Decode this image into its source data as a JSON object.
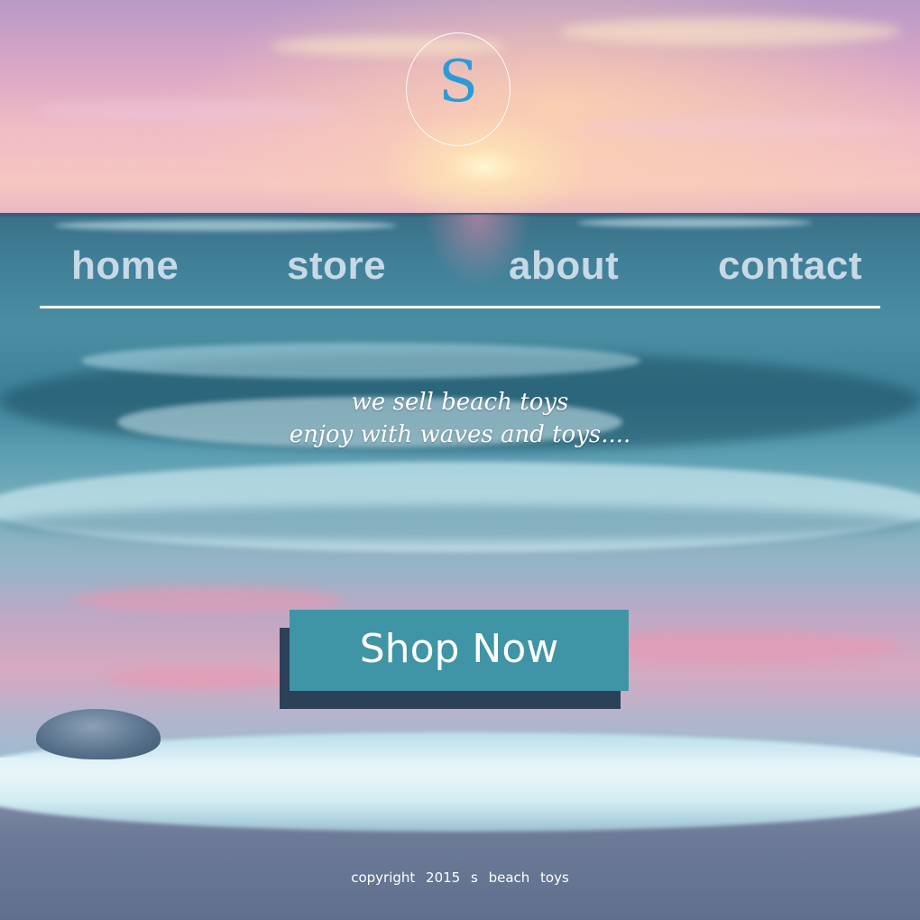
{
  "logo": {
    "letter": "S"
  },
  "nav": {
    "items": [
      {
        "label": "home"
      },
      {
        "label": "store"
      },
      {
        "label": "about"
      },
      {
        "label": "contact"
      }
    ]
  },
  "hero": {
    "tagline_line1": "we sell beach toys",
    "tagline_line2": "enjoy with waves and toys...."
  },
  "cta": {
    "label": "Shop Now"
  },
  "footer": {
    "text": "copyright  2015  s  beach  toys"
  },
  "colors": {
    "logo_letter": "#2b9bd8",
    "button_face": "#3f95a5",
    "button_shadow": "#2c4058",
    "nav_text": "#d2e1eb",
    "rule": "#ffffff"
  }
}
